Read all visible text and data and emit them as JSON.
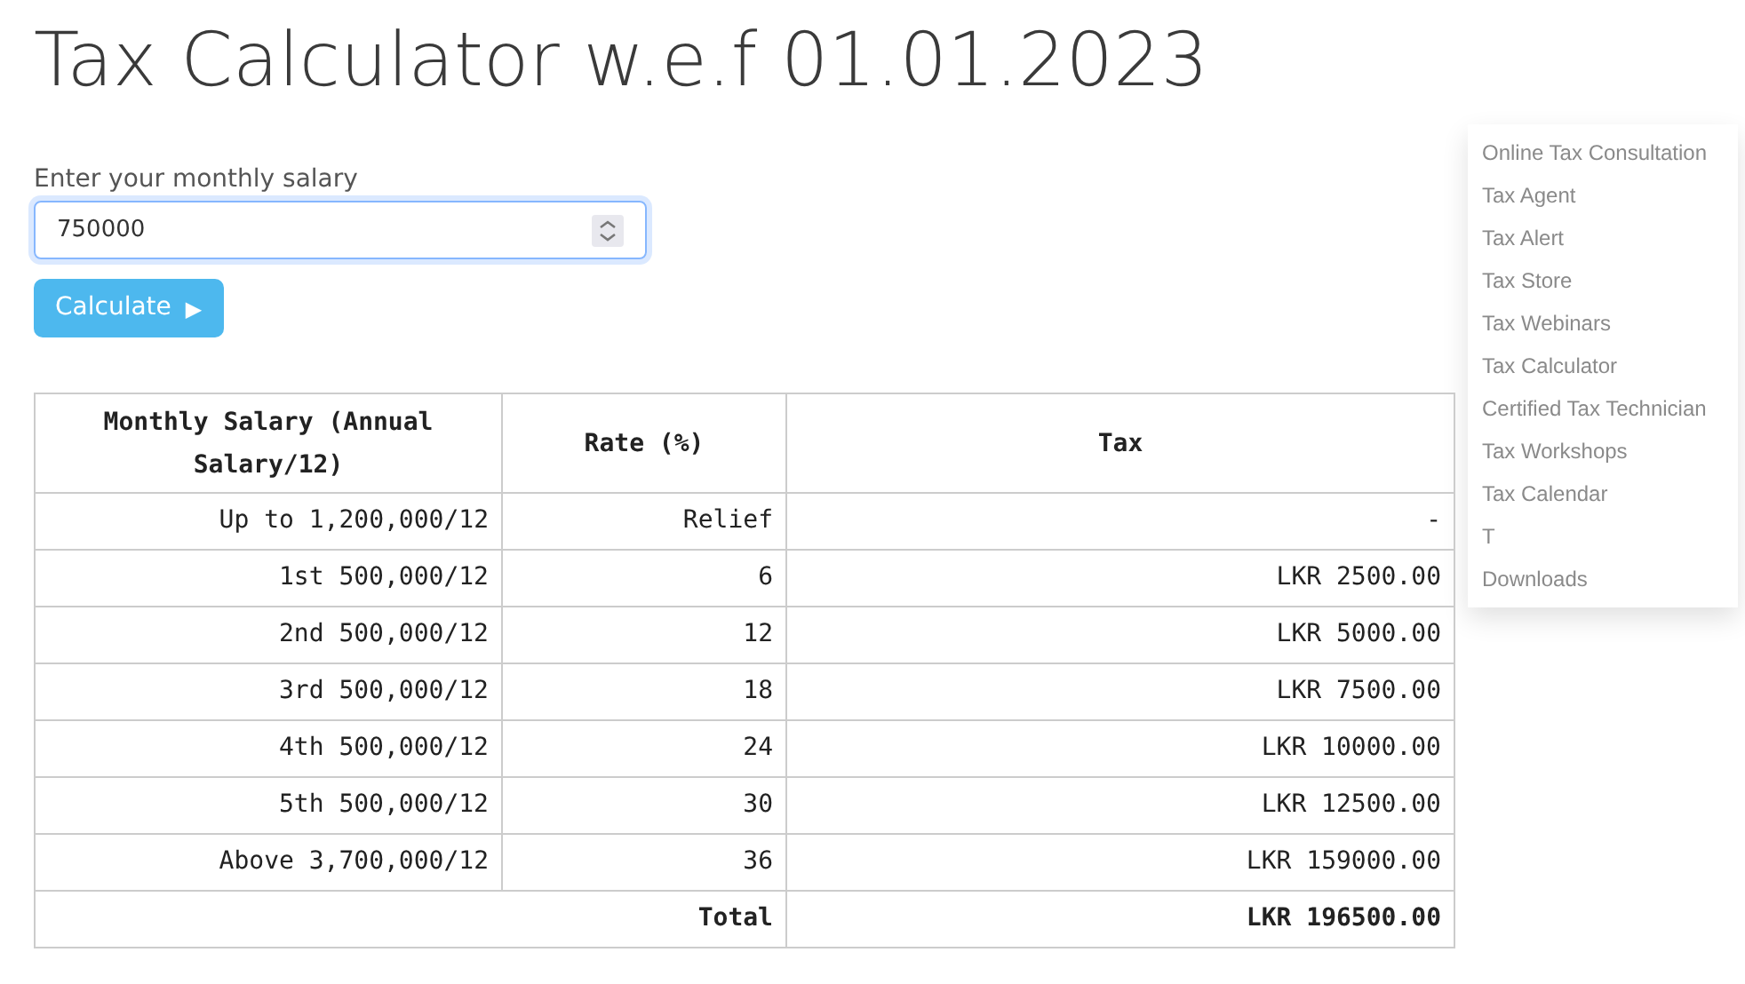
{
  "title": "Tax Calculator w.e.f 01.01.2023",
  "menu": {
    "items": [
      "Online Tax Consultation",
      "Tax Agent",
      "Tax Alert",
      "Tax Store",
      "Tax Webinars",
      "Tax Calculator",
      "Certified Tax Technician",
      "Tax Workshops",
      "Tax Calendar",
      "T",
      "Downloads"
    ]
  },
  "salary_field": {
    "label": "Enter your monthly salary",
    "value": "750000"
  },
  "calculate_button": {
    "label": "Calculate",
    "icon": "▶"
  },
  "table": {
    "columns": [
      "Monthly Salary (Annual Salary/12)",
      "Rate (%)",
      "Tax"
    ],
    "rows": [
      [
        "Up to 1,200,000/12",
        "Relief",
        "-"
      ],
      [
        "1st 500,000/12",
        "6",
        "LKR 2500.00"
      ],
      [
        "2nd 500,000/12",
        "12",
        "LKR 5000.00"
      ],
      [
        "3rd 500,000/12",
        "18",
        "LKR 7500.00"
      ],
      [
        "4th 500,000/12",
        "24",
        "LKR 10000.00"
      ],
      [
        "5th 500,000/12",
        "30",
        "LKR 12500.00"
      ],
      [
        "Above 3,700,000/12",
        "36",
        "LKR 159000.00"
      ]
    ],
    "total": {
      "label": "Total",
      "value": "LKR 196500.00"
    }
  }
}
